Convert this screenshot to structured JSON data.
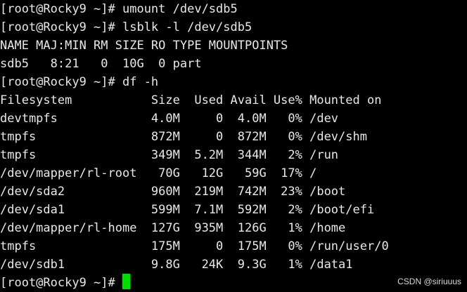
{
  "terminal": {
    "lines": [
      "[root@Rocky9 ~]# umount /dev/sdb5",
      "[root@Rocky9 ~]# lsblk -l /dev/sdb5",
      "NAME MAJ:MIN RM SIZE RO TYPE MOUNTPOINTS",
      "sdb5   8:21   0  10G  0 part",
      "[root@Rocky9 ~]# df -h",
      "Filesystem           Size  Used Avail Use% Mounted on",
      "devtmpfs             4.0M     0  4.0M   0% /dev",
      "tmpfs                872M     0  872M   0% /dev/shm",
      "tmpfs                349M  5.2M  344M   2% /run",
      "/dev/mapper/rl-root   70G   12G   59G  17% /",
      "/dev/sda2            960M  219M  742M  23% /boot",
      "/dev/sda1            599M  7.1M  592M   2% /boot/efi",
      "/dev/mapper/rl-home  127G  935M  126G   1% /home",
      "tmpfs                175M     0  175M   0% /run/user/0",
      "/dev/sdb1            9.8G   24K  9.3G   1% /data1"
    ],
    "prompt": "[root@Rocky9 ~]# ",
    "text_color": "#e8e8e8",
    "background_color": "#000000",
    "cursor_color": "#00dd00"
  },
  "watermark": "CSDN @siriuuus"
}
